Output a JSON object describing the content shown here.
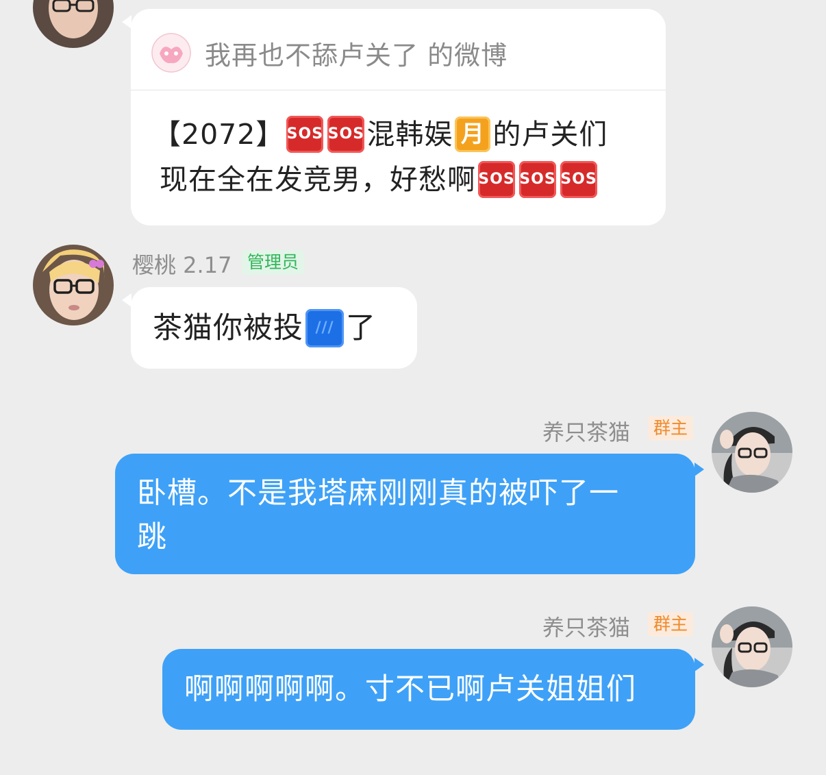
{
  "top_avatar": {
    "desc": "user-avatar"
  },
  "weibo_card": {
    "source_title": "我再也不舔卢关了 的微博",
    "line1_prefix": "【2072】",
    "sos1": "SOS",
    "sos2": "SOS",
    "line1_mid": "混韩娱",
    "moon": "月",
    "line1_suffix": "的卢关们",
    "line2": "现在全在发竞男，好愁啊",
    "sos3": "SOS",
    "sos4": "SOS",
    "sos5": "SOS"
  },
  "msg_cherry": {
    "sender": "樱桃 2.17",
    "badge": "管理员",
    "text_before": "茶猫你被投",
    "emoji_text": "///",
    "text_after": "了"
  },
  "msg_owner_1": {
    "sender": "养只茶猫",
    "badge": "群主",
    "line1": "卧槽。不是我塔麻刚刚真的被吓了一",
    "line2": "跳"
  },
  "msg_owner_2": {
    "sender": "养只茶猫",
    "badge": "群主",
    "text": "啊啊啊啊啊。寸不已啊卢关姐姐们"
  }
}
